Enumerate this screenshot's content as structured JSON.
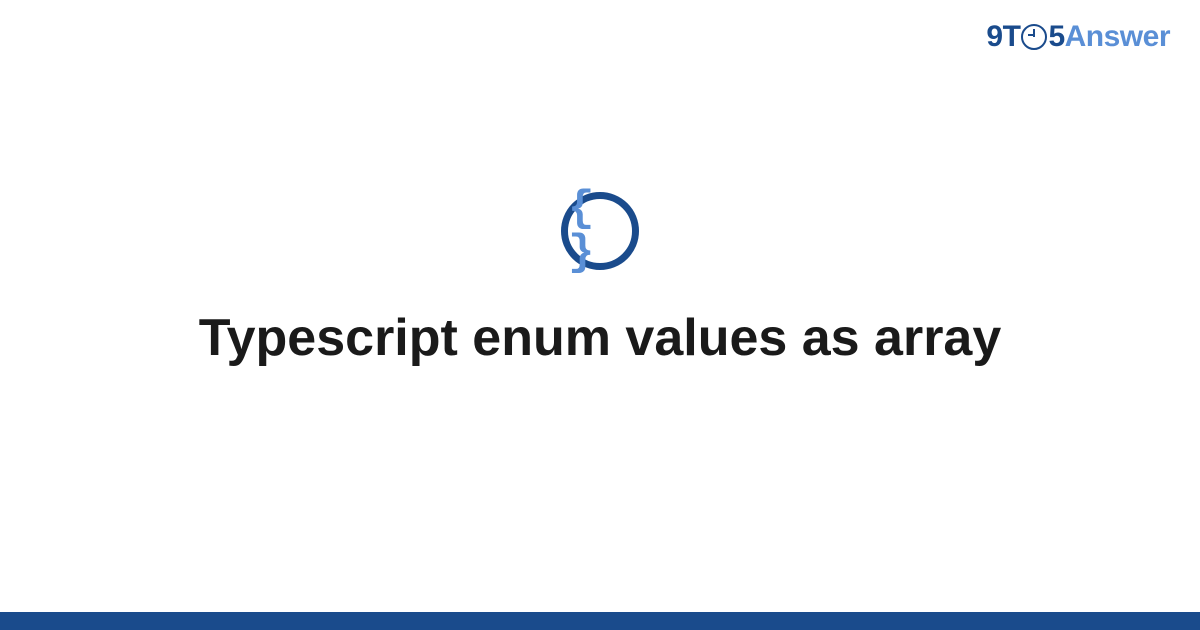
{
  "header": {
    "logo": {
      "part1": "9T",
      "part2": "5",
      "part3": "Answer"
    }
  },
  "main": {
    "icon_glyph": "{ }",
    "title": "Typescript enum values as array"
  },
  "colors": {
    "brand_primary": "#1a4b8c",
    "brand_secondary": "#5a8fd6"
  }
}
